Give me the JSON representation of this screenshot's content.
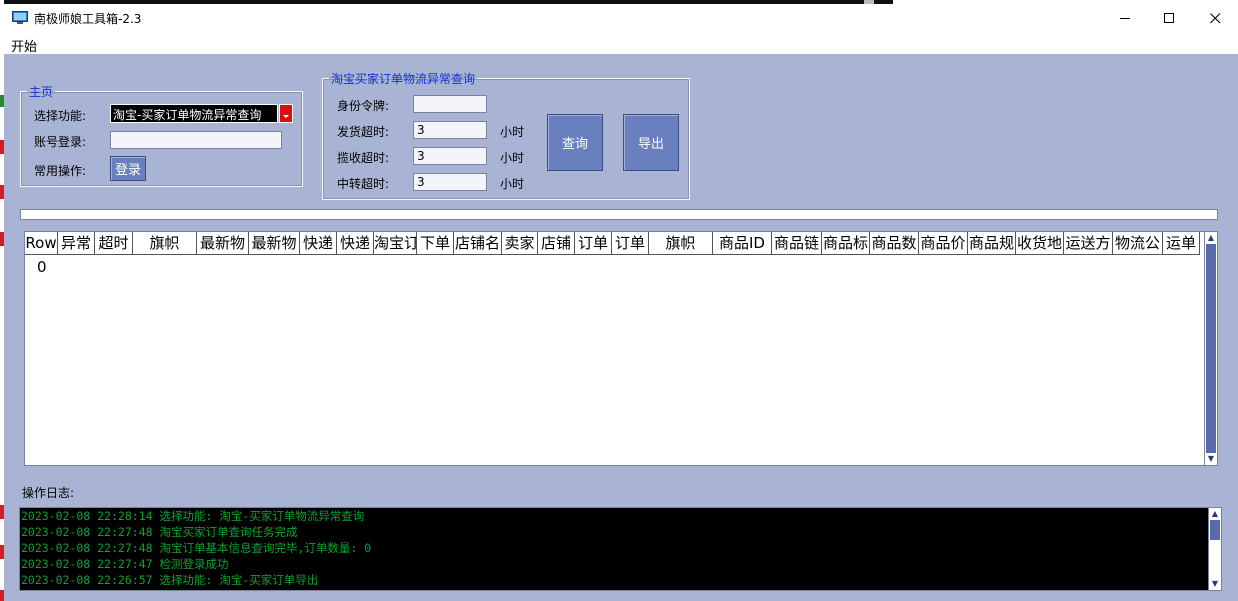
{
  "window": {
    "title": "南极师娘工具箱-2.3"
  },
  "menu": {
    "start": "开始"
  },
  "home_group": {
    "legend": "主页",
    "select_label": "选择功能:",
    "select_value": "淘宝-买家订单物流异常查询",
    "login_label": "账号登录:",
    "login_value": "",
    "ops_label": "常用操作:",
    "login_button": "登录"
  },
  "query_group": {
    "legend": "淘宝买家订单物流异常查询",
    "token_label": "身份令牌:",
    "token_value": "",
    "ship_label": "发货超时:",
    "ship_value": "3",
    "collect_label": "揽收超时:",
    "collect_value": "3",
    "transit_label": "中转超时:",
    "transit_value": "3",
    "unit": "小时",
    "query_button": "查询",
    "export_button": "导出"
  },
  "grid": {
    "columns": [
      "Row",
      "异常",
      "超时",
      "旗帜",
      "最新物",
      "最新物",
      "快递",
      "快递",
      "淘宝订",
      "下单",
      "店铺名",
      "卖家",
      "店铺",
      "订单",
      "订单",
      "旗帜",
      "商品ID",
      "商品链",
      "商品标",
      "商品数",
      "商品价",
      "商品规",
      "收货地",
      "运送方",
      "物流公",
      "运单"
    ],
    "rows": [
      [
        "0"
      ]
    ]
  },
  "log": {
    "label": "操作日志:",
    "lines": [
      "2023-02-08 22:28:14 选择功能: 淘宝-买家订单物流异常查询",
      "2023-02-08 22:27:48 淘宝买家订单查询任务完成",
      "2023-02-08 22:27:48 淘宝订单基本信息查询完毕,订单数量: 0",
      "2023-02-08 22:27:47 检测登录成功",
      "2023-02-08 22:26:57 选择功能: 淘宝-买家订单导出"
    ]
  },
  "colors": {
    "client_bg": "#a9b4d4",
    "button": "#6a7fbe",
    "legend": "#1133cc",
    "log_text": "#0fa030",
    "select_arrow": "#d80f0f"
  }
}
